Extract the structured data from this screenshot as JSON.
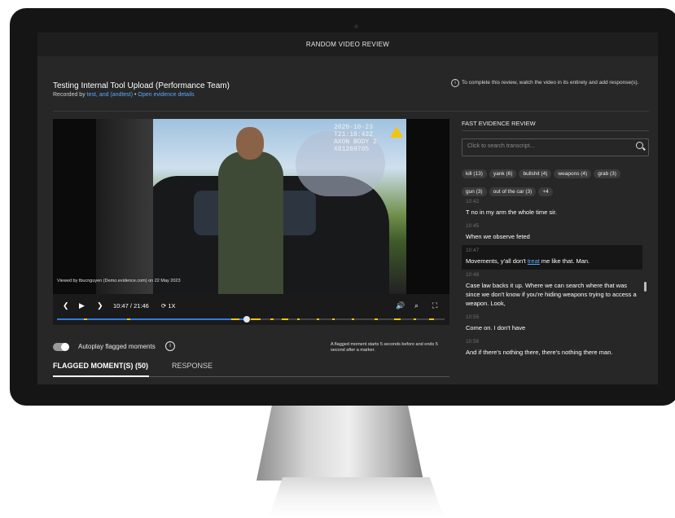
{
  "header": {
    "title": "RANDOM VIDEO REVIEW"
  },
  "case": {
    "title": "Testing Internal Tool Upload (Performance Team)",
    "recorded_prefix": "Recorded by ",
    "recorded_by": "test, and (andtest)",
    "separator": " • ",
    "details_link": "Open evidence details"
  },
  "instructions": "To complete this review, watch the video in its entirety and add response(s).",
  "video": {
    "timestamp_line1": "2020-10-23 T21:18:42Z",
    "timestamp_line2": "AXON BODY 2 X81269705",
    "watermark": "Viewed by tbucnguyen (Demo.evidence.com) on 22 May 2023",
    "current_time": "10:47",
    "time_separator": "/",
    "duration": "21:46",
    "speed": "1X",
    "progress": 0.49,
    "icons": [
      "prev-icon",
      "play-icon",
      "next-icon",
      "speed-icon",
      "volume-icon",
      "zoom-icon",
      "fullscreen-icon"
    ]
  },
  "autoplay": {
    "label": "Autoplay flagged moments",
    "enabled": true
  },
  "flag_note": "A flagged moment starts 5 seconds before and ends 5 second after a marker.",
  "tabs": [
    {
      "label": "FLAGGED MOMENT(S) (50)"
    },
    {
      "label": "RESPONSE"
    }
  ],
  "panel": {
    "title": "FAST EVIDENCE REVIEW",
    "search_placeholder": "Click to search transcript...",
    "chips": [
      "kill (13)",
      "yank (6)",
      "bullshit (4)",
      "weapons (4)",
      "grab (3)",
      "gun (3)",
      "out of the car (3)",
      "+4"
    ],
    "transcript": [
      {
        "time": "10:42",
        "text": "T no in my arm the whole time sir."
      },
      {
        "time": "10:45",
        "text": "When we observe feted"
      },
      {
        "time": "10:47",
        "text_before": "Movements, y'all don't ",
        "highlight": "treat",
        "text_after": " me like that. Man."
      },
      {
        "time": "10:48",
        "text": "Case law backs it up. Where we can search where that was since we don't know if you're hiding weapons trying to access a weapon. Look,"
      },
      {
        "time": "10:55",
        "text": "Come on. I don't have"
      },
      {
        "time": "10:56",
        "text": "And if there's nothing there, there's nothing there man."
      }
    ]
  },
  "colors": {
    "accent": "#5aa9ff",
    "marker": "#f1c40f",
    "progress": "#2f7de1",
    "background": "#272727"
  }
}
